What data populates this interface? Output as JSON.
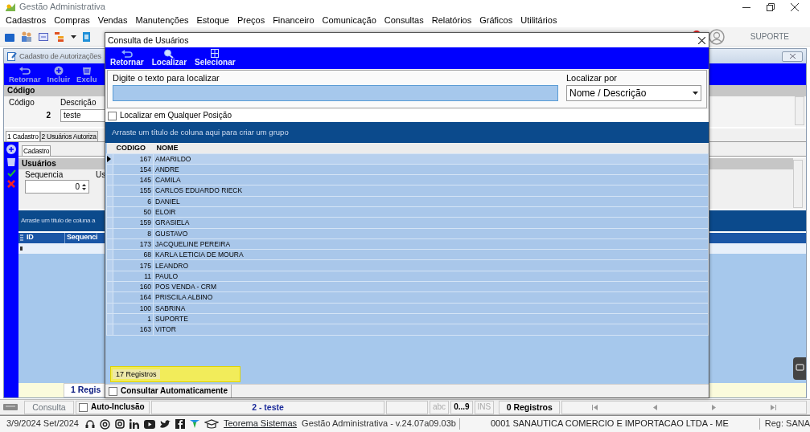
{
  "app": {
    "title": "Gestão Administrativa",
    "menu": [
      "Cadastros",
      "Compras",
      "Vendas",
      "Manutenções",
      "Estoque",
      "Preços",
      "Financeiro",
      "Comunicação",
      "Consultas",
      "Relatórios",
      "Gráficos",
      "Utilitários"
    ],
    "user": "SUPORTE"
  },
  "form": {
    "title": "Cadastro de Autorizações",
    "toolbar": [
      "Retornar",
      "Incluir",
      "Exclu"
    ],
    "section": "Código",
    "fields": [
      {
        "label": "Código",
        "value": "2"
      },
      {
        "label": "Descrição",
        "value": "teste"
      }
    ],
    "tabs": [
      {
        "label": "1 Cadastro",
        "selected": true
      },
      {
        "label": "2 Usuários Autoriza",
        "selected": false
      }
    ],
    "subtab": "Cadastro",
    "users_section": "Usuários",
    "sequence": {
      "label": "Sequencia",
      "value": "0"
    },
    "user_label": "Us",
    "group_hint": "Arraste um título de coluna a",
    "grid_columns": [
      "ID",
      "Sequenci"
    ],
    "footer": "1 Regis"
  },
  "dialog": {
    "title": "Consulta de Usuários",
    "toolbar": [
      "Retornar",
      "Localizar",
      "Selecionar"
    ],
    "search_label": "Digite o texto para localizar",
    "search_by_label": "Localizar por",
    "search_by": "Nome / Descrição",
    "any_position": {
      "label": "Localizar em Qualquer Posição",
      "checked": false
    },
    "group_hint": "Arraste um título de coluna aqui para criar um grupo",
    "columns": [
      "CODIGO",
      "NOME"
    ],
    "rows": [
      {
        "code": "167",
        "name": "AMARILDO",
        "selected": true
      },
      {
        "code": "154",
        "name": "ANDRE",
        "selected": false
      },
      {
        "code": "145",
        "name": "CAMILA",
        "selected": false
      },
      {
        "code": "155",
        "name": "CARLOS EDUARDO RIECK",
        "selected": false
      },
      {
        "code": "6",
        "name": "DANIEL",
        "selected": false
      },
      {
        "code": "50",
        "name": "ELOIR",
        "selected": false
      },
      {
        "code": "159",
        "name": "GRASIELA",
        "selected": false
      },
      {
        "code": "8",
        "name": "GUSTAVO",
        "selected": false
      },
      {
        "code": "173",
        "name": "JACQUELINE PEREIRA",
        "selected": false
      },
      {
        "code": "68",
        "name": "KARLA LETICIA DE MOURA",
        "selected": false
      },
      {
        "code": "175",
        "name": "LEANDRO",
        "selected": false
      },
      {
        "code": "11",
        "name": "PAULO",
        "selected": false
      },
      {
        "code": "160",
        "name": "POS VENDA - CRM",
        "selected": false
      },
      {
        "code": "164",
        "name": "PRISCILA ALBINO",
        "selected": false
      },
      {
        "code": "100",
        "name": "SABRINA",
        "selected": false
      },
      {
        "code": "1",
        "name": "SUPORTE",
        "selected": false
      },
      {
        "code": "163",
        "name": "VITOR",
        "selected": false
      }
    ],
    "count": "17 Registros",
    "auto": {
      "label": "Consultar Automaticamente",
      "checked": false
    }
  },
  "status_bar": {
    "mode": "Consulta",
    "auto_inclusion": {
      "label": "Auto-Inclusão",
      "checked": false
    },
    "record": "2 - teste",
    "indicators": [
      {
        "label": "abc",
        "disabled": true
      },
      {
        "label": "0...9",
        "disabled": false
      },
      {
        "label": "INS",
        "disabled": true
      }
    ],
    "count": "0 Registros"
  },
  "footer": {
    "date": "3/9/2024 Set/2024",
    "link": "Teorema Sistemas",
    "version": "Gestão Administrativa - v.24.07a09.03b",
    "company": "0001 SANAUTICA COMERCIO E IMPORTACAO LTDA - ME",
    "reg": "Reg: SANA"
  }
}
